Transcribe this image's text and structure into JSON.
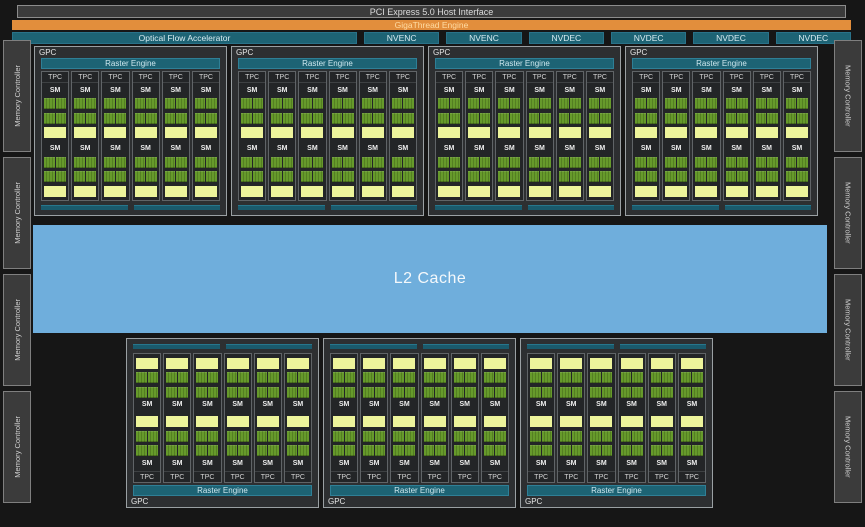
{
  "title_bars": {
    "pcie": "PCI Express 5.0 Host Interface",
    "gigathread": "GigaThread Engine"
  },
  "media_row": {
    "optical_flow": "Optical Flow Accelerator",
    "encoders": [
      "NVENC",
      "NVENC",
      "NVDEC",
      "NVDEC",
      "NVDEC",
      "NVDEC"
    ]
  },
  "memory": {
    "left": [
      "Memory Controller",
      "Memory Controller",
      "Memory Controller",
      "Memory Controller"
    ],
    "right": [
      "Memory Controller",
      "Memory Controller",
      "Memory Controller",
      "Memory Controller"
    ]
  },
  "l2_cache": {
    "label": "L2 Cache"
  },
  "gpu": {
    "gpc_label": "GPC",
    "raster_engine_label": "Raster Engine",
    "tpc_label": "TPC",
    "sm_label": "SM",
    "top_gpc_count": 4,
    "bottom_gpc_count": 3,
    "tpcs_per_gpc": 6,
    "sms_per_tpc": 2,
    "green_rows_per_sm": 2,
    "cells_per_green_row": 2
  },
  "colors": {
    "background": "#161616",
    "orange": "#E28E3C",
    "teal": "#1D6374",
    "green": "#669A2B",
    "yellow": "#EDF49B",
    "l2_blue": "#6FAEDC",
    "gray_bar": "#3B3B3B",
    "gpc_fill": "#2D2F31",
    "tpc_fill": "#232527"
  }
}
